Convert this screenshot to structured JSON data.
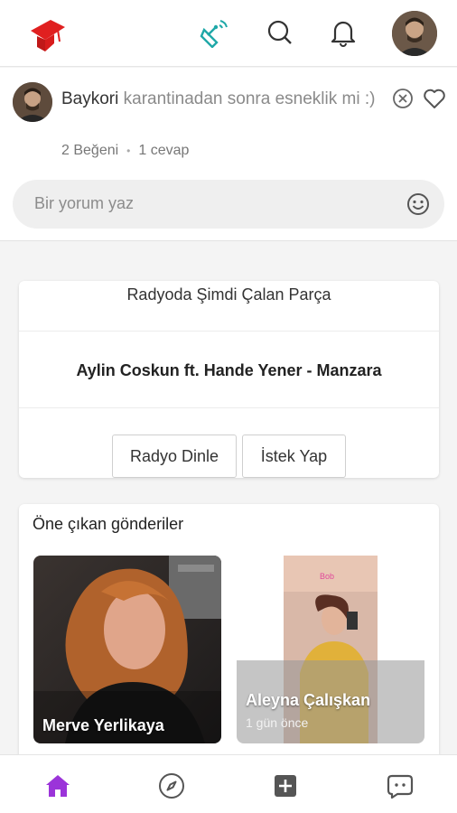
{
  "header": {
    "logo_icon": "graduation-cap-icon",
    "icons": [
      "satellite-dish-icon",
      "search-icon",
      "bell-icon"
    ],
    "accent_color": "#e02020",
    "satellite_color": "#1fa8a8"
  },
  "comment": {
    "username": "Baykori",
    "text": "karantinadan sonra esneklik mi :)",
    "likes": "2 Beğeni",
    "replies": "1 cevap",
    "input_placeholder": "Bir yorum yaz"
  },
  "radio": {
    "title": "Radyoda Şimdi Çalan Parça",
    "song": "Aylin Coskun ft. Hande Yener - Manzara",
    "listen_button": "Radyo Dinle",
    "request_button": "İstek Yap"
  },
  "featured": {
    "title": "Öne çıkan gönderiler",
    "posts": [
      {
        "name": "Merve Yerlikaya",
        "time": ""
      },
      {
        "name": "Aleyna Çalışkan",
        "time": "1 gün önce"
      }
    ]
  },
  "bottom_nav": {
    "items": [
      "home-icon",
      "compass-icon",
      "add-square-icon",
      "chat-icon"
    ],
    "active_color": "#9b34d9"
  }
}
